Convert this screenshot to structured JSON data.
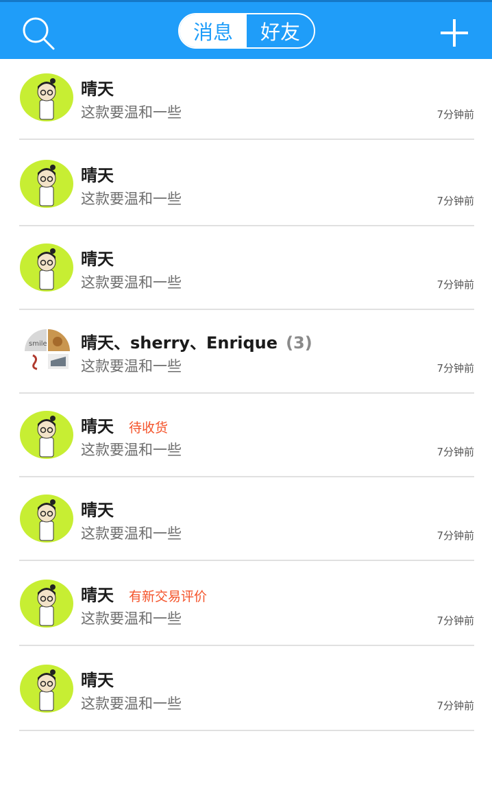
{
  "header": {
    "search_icon": "search-icon",
    "tabs": [
      {
        "label": "消息",
        "active": true
      },
      {
        "label": "好友",
        "active": false
      }
    ],
    "add_icon": "plus-icon",
    "colors": {
      "bar": "#1f9df9",
      "tag": "#f4532a"
    }
  },
  "conversations": [
    {
      "name": "晴天",
      "count": "",
      "tag": "",
      "preview": "这款要温和一些",
      "time": "7分钟前",
      "avatar": "cartoon-avatar"
    },
    {
      "name": "晴天",
      "count": "",
      "tag": "",
      "preview": "这款要温和一些",
      "time": "7分钟前",
      "avatar": "cartoon-avatar"
    },
    {
      "name": "晴天",
      "count": "",
      "tag": "",
      "preview": "这款要温和一些",
      "time": "7分钟前",
      "avatar": "cartoon-avatar"
    },
    {
      "name": "晴天、sherry、Enrique",
      "count": "(3)",
      "tag": "",
      "preview": "这款要温和一些",
      "time": "7分钟前",
      "avatar": "group-avatar"
    },
    {
      "name": "晴天",
      "count": "",
      "tag": "待收货",
      "preview": "这款要温和一些",
      "time": "7分钟前",
      "avatar": "cartoon-avatar"
    },
    {
      "name": "晴天",
      "count": "",
      "tag": "",
      "preview": "这款要温和一些",
      "time": "7分钟前",
      "avatar": "cartoon-avatar"
    },
    {
      "name": "晴天",
      "count": "",
      "tag": "有新交易评价",
      "preview": "这款要温和一些",
      "time": "7分钟前",
      "avatar": "cartoon-avatar"
    },
    {
      "name": "晴天",
      "count": "",
      "tag": "",
      "preview": "这款要温和一些",
      "time": "7分钟前",
      "avatar": "cartoon-avatar"
    }
  ]
}
